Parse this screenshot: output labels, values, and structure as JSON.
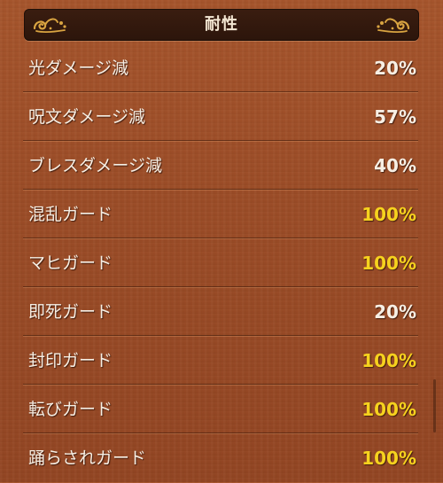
{
  "header": {
    "title": "耐性"
  },
  "resistances": [
    {
      "label": "光ダメージ減",
      "value": "20%",
      "maxed": false
    },
    {
      "label": "呪文ダメージ減",
      "value": "57%",
      "maxed": false
    },
    {
      "label": "ブレスダメージ減",
      "value": "40%",
      "maxed": false
    },
    {
      "label": "混乱ガード",
      "value": "100%",
      "maxed": true
    },
    {
      "label": "マヒガード",
      "value": "100%",
      "maxed": true
    },
    {
      "label": "即死ガード",
      "value": "20%",
      "maxed": false
    },
    {
      "label": "封印ガード",
      "value": "100%",
      "maxed": true
    },
    {
      "label": "転びガード",
      "value": "100%",
      "maxed": true
    },
    {
      "label": "踊らされガード",
      "value": "100%",
      "maxed": true
    }
  ],
  "colors": {
    "normal_value": "#f7efe4",
    "maxed_value": "#f6d21e",
    "panel": "#9c4d27",
    "header": "#2c150b"
  },
  "icons": [
    "flourish-ornament-icon"
  ]
}
